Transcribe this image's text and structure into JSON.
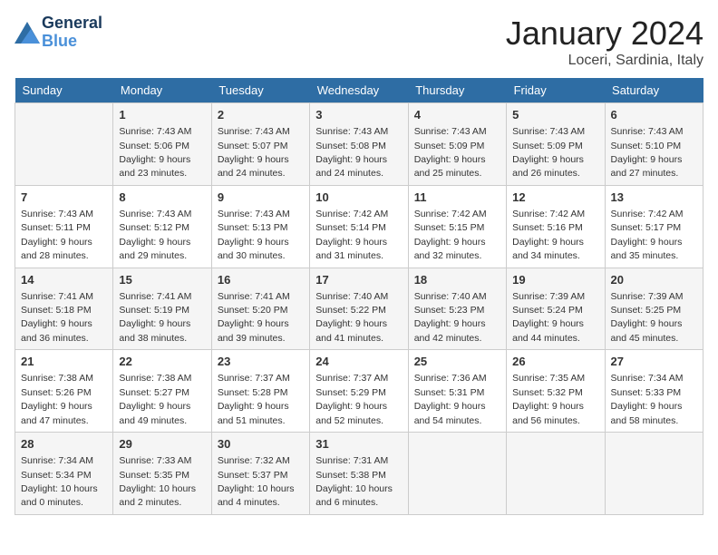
{
  "logo": {
    "line1": "General",
    "line2": "Blue"
  },
  "title": "January 2024",
  "location": "Loceri, Sardinia, Italy",
  "weekdays": [
    "Sunday",
    "Monday",
    "Tuesday",
    "Wednesday",
    "Thursday",
    "Friday",
    "Saturday"
  ],
  "weeks": [
    [
      {
        "day": "",
        "info": ""
      },
      {
        "day": "1",
        "info": "Sunrise: 7:43 AM\nSunset: 5:06 PM\nDaylight: 9 hours and 23 minutes."
      },
      {
        "day": "2",
        "info": "Sunrise: 7:43 AM\nSunset: 5:07 PM\nDaylight: 9 hours and 24 minutes."
      },
      {
        "day": "3",
        "info": "Sunrise: 7:43 AM\nSunset: 5:08 PM\nDaylight: 9 hours and 24 minutes."
      },
      {
        "day": "4",
        "info": "Sunrise: 7:43 AM\nSunset: 5:09 PM\nDaylight: 9 hours and 25 minutes."
      },
      {
        "day": "5",
        "info": "Sunrise: 7:43 AM\nSunset: 5:09 PM\nDaylight: 9 hours and 26 minutes."
      },
      {
        "day": "6",
        "info": "Sunrise: 7:43 AM\nSunset: 5:10 PM\nDaylight: 9 hours and 27 minutes."
      }
    ],
    [
      {
        "day": "7",
        "info": "Sunrise: 7:43 AM\nSunset: 5:11 PM\nDaylight: 9 hours and 28 minutes."
      },
      {
        "day": "8",
        "info": "Sunrise: 7:43 AM\nSunset: 5:12 PM\nDaylight: 9 hours and 29 minutes."
      },
      {
        "day": "9",
        "info": "Sunrise: 7:43 AM\nSunset: 5:13 PM\nDaylight: 9 hours and 30 minutes."
      },
      {
        "day": "10",
        "info": "Sunrise: 7:42 AM\nSunset: 5:14 PM\nDaylight: 9 hours and 31 minutes."
      },
      {
        "day": "11",
        "info": "Sunrise: 7:42 AM\nSunset: 5:15 PM\nDaylight: 9 hours and 32 minutes."
      },
      {
        "day": "12",
        "info": "Sunrise: 7:42 AM\nSunset: 5:16 PM\nDaylight: 9 hours and 34 minutes."
      },
      {
        "day": "13",
        "info": "Sunrise: 7:42 AM\nSunset: 5:17 PM\nDaylight: 9 hours and 35 minutes."
      }
    ],
    [
      {
        "day": "14",
        "info": "Sunrise: 7:41 AM\nSunset: 5:18 PM\nDaylight: 9 hours and 36 minutes."
      },
      {
        "day": "15",
        "info": "Sunrise: 7:41 AM\nSunset: 5:19 PM\nDaylight: 9 hours and 38 minutes."
      },
      {
        "day": "16",
        "info": "Sunrise: 7:41 AM\nSunset: 5:20 PM\nDaylight: 9 hours and 39 minutes."
      },
      {
        "day": "17",
        "info": "Sunrise: 7:40 AM\nSunset: 5:22 PM\nDaylight: 9 hours and 41 minutes."
      },
      {
        "day": "18",
        "info": "Sunrise: 7:40 AM\nSunset: 5:23 PM\nDaylight: 9 hours and 42 minutes."
      },
      {
        "day": "19",
        "info": "Sunrise: 7:39 AM\nSunset: 5:24 PM\nDaylight: 9 hours and 44 minutes."
      },
      {
        "day": "20",
        "info": "Sunrise: 7:39 AM\nSunset: 5:25 PM\nDaylight: 9 hours and 45 minutes."
      }
    ],
    [
      {
        "day": "21",
        "info": "Sunrise: 7:38 AM\nSunset: 5:26 PM\nDaylight: 9 hours and 47 minutes."
      },
      {
        "day": "22",
        "info": "Sunrise: 7:38 AM\nSunset: 5:27 PM\nDaylight: 9 hours and 49 minutes."
      },
      {
        "day": "23",
        "info": "Sunrise: 7:37 AM\nSunset: 5:28 PM\nDaylight: 9 hours and 51 minutes."
      },
      {
        "day": "24",
        "info": "Sunrise: 7:37 AM\nSunset: 5:29 PM\nDaylight: 9 hours and 52 minutes."
      },
      {
        "day": "25",
        "info": "Sunrise: 7:36 AM\nSunset: 5:31 PM\nDaylight: 9 hours and 54 minutes."
      },
      {
        "day": "26",
        "info": "Sunrise: 7:35 AM\nSunset: 5:32 PM\nDaylight: 9 hours and 56 minutes."
      },
      {
        "day": "27",
        "info": "Sunrise: 7:34 AM\nSunset: 5:33 PM\nDaylight: 9 hours and 58 minutes."
      }
    ],
    [
      {
        "day": "28",
        "info": "Sunrise: 7:34 AM\nSunset: 5:34 PM\nDaylight: 10 hours and 0 minutes."
      },
      {
        "day": "29",
        "info": "Sunrise: 7:33 AM\nSunset: 5:35 PM\nDaylight: 10 hours and 2 minutes."
      },
      {
        "day": "30",
        "info": "Sunrise: 7:32 AM\nSunset: 5:37 PM\nDaylight: 10 hours and 4 minutes."
      },
      {
        "day": "31",
        "info": "Sunrise: 7:31 AM\nSunset: 5:38 PM\nDaylight: 10 hours and 6 minutes."
      },
      {
        "day": "",
        "info": ""
      },
      {
        "day": "",
        "info": ""
      },
      {
        "day": "",
        "info": ""
      }
    ]
  ]
}
